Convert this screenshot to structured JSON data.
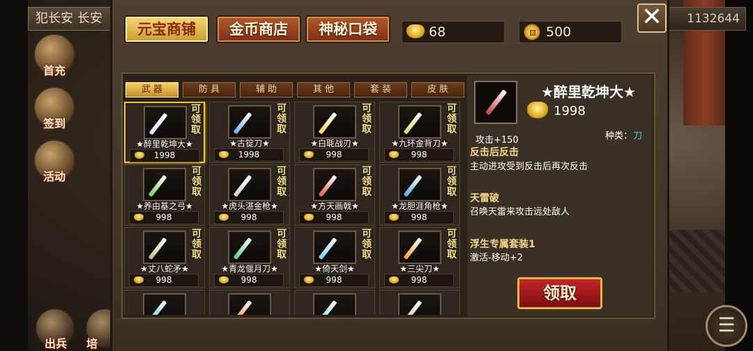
{
  "hud": {
    "city_label": "犯长安 长安",
    "currency_value": "1132644",
    "side_menu": [
      "首充",
      "签到",
      "活动"
    ],
    "bottom_menu": [
      "出兵",
      "培"
    ],
    "menu_icon": "list-icon"
  },
  "shop": {
    "tabs": [
      {
        "label": "元宝商铺",
        "active": true
      },
      {
        "label": "金币商店",
        "active": false
      },
      {
        "label": "神秘口袋",
        "active": false
      }
    ],
    "ingot_balance": "68",
    "coin_balance": "500",
    "close_icon": "close-icon",
    "subtabs": [
      {
        "label": "武 器",
        "active": true
      },
      {
        "label": "防 具",
        "active": false
      },
      {
        "label": "辅 助",
        "active": false
      },
      {
        "label": "其 他",
        "active": false
      },
      {
        "label": "套 装",
        "active": false
      },
      {
        "label": "皮 肤",
        "active": false
      }
    ],
    "claim_tag": "可领取",
    "items": [
      {
        "name": "★醉里乾坤大★",
        "price": "1998",
        "color": "#e0e0ff",
        "selected": true
      },
      {
        "name": "★古锭刀★",
        "price": "1998",
        "color": "#6ab0ff",
        "selected": false
      },
      {
        "name": "★白毦战刃★",
        "price": "998",
        "color": "#ffd35a",
        "selected": false
      },
      {
        "name": "★九环金背刀★",
        "price": "998",
        "color": "#c8e05a",
        "selected": false
      },
      {
        "name": "★养由基之弓★",
        "price": "998",
        "color": "#7ad04a",
        "selected": false
      },
      {
        "name": "★虎头湛金枪★",
        "price": "998",
        "color": "#d0d0d0",
        "selected": false
      },
      {
        "name": "★方天画戟★",
        "price": "998",
        "color": "#e05a4a",
        "selected": false
      },
      {
        "name": "★龙胆涯角枪★",
        "price": "998",
        "color": "#4ab0e0",
        "selected": false
      },
      {
        "name": "★丈八蛇矛★",
        "price": "998",
        "color": "#c0c080",
        "selected": false
      },
      {
        "name": "★青龙偃月刀★",
        "price": "998",
        "color": "#5ad07a",
        "selected": false
      },
      {
        "name": "★倚天剑★",
        "price": "998",
        "color": "#7ad0ff",
        "selected": false
      },
      {
        "name": "★三尖刀★",
        "price": "998",
        "color": "#ff9a3a",
        "selected": false
      },
      {
        "name": "",
        "price": "",
        "color": "#5ac8e0",
        "selected": false
      },
      {
        "name": "",
        "price": "",
        "color": "#ff7a2a",
        "selected": false
      },
      {
        "name": "",
        "price": "",
        "color": "#7ae0d0",
        "selected": false
      },
      {
        "name": "",
        "price": "",
        "color": "#c0c0c0",
        "selected": false
      }
    ]
  },
  "detail": {
    "name": "★醉里乾坤大★",
    "price": "1998",
    "stat": "攻击+150",
    "type_label": "种类：",
    "type_value": "刀",
    "skill1_title": "反击后反击",
    "skill1_desc": "主动进攻受到反击后再次反击",
    "skill2_title": "天雷破",
    "skill2_desc": "召唤天雷来攻击远处敌人",
    "set_title": "浮生专属套装1",
    "set_desc": "激活-移动+2",
    "claim_button": "领取"
  }
}
